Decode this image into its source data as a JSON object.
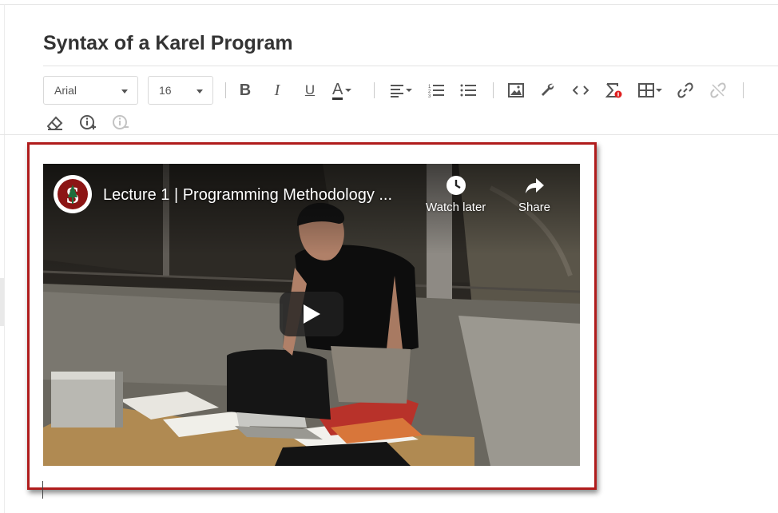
{
  "page": {
    "title": "Syntax of a Karel Program"
  },
  "toolbar": {
    "font_family": "Arial",
    "font_size": "16",
    "buttons": [
      {
        "name": "bold",
        "label": "B"
      },
      {
        "name": "italic",
        "label": "I"
      },
      {
        "name": "underline",
        "label": "U"
      },
      {
        "name": "font-color",
        "label": "A"
      }
    ]
  },
  "icons": {
    "align": "align-left-icon",
    "ordered_list": "ordered-list-icon",
    "unordered_list": "unordered-list-icon",
    "image": "image-icon",
    "wrench": "wrench-icon",
    "code": "code-icon",
    "clear_format": "clear-formatting-icon",
    "table": "table-icon",
    "link": "link-icon",
    "unlink": "unlink-icon",
    "eraser": "eraser-icon",
    "info_add": "info-add-icon",
    "info_remove": "info-remove-icon"
  },
  "video": {
    "title": "Lecture 1 | Programming Methodology ...",
    "watch_later_label": "Watch later",
    "share_label": "Share",
    "channel_logo_letter": "S"
  },
  "colors": {
    "selection_border": "#b01c1c",
    "stanford_red": "#8c1515",
    "toolbar_icon": "#555555"
  }
}
